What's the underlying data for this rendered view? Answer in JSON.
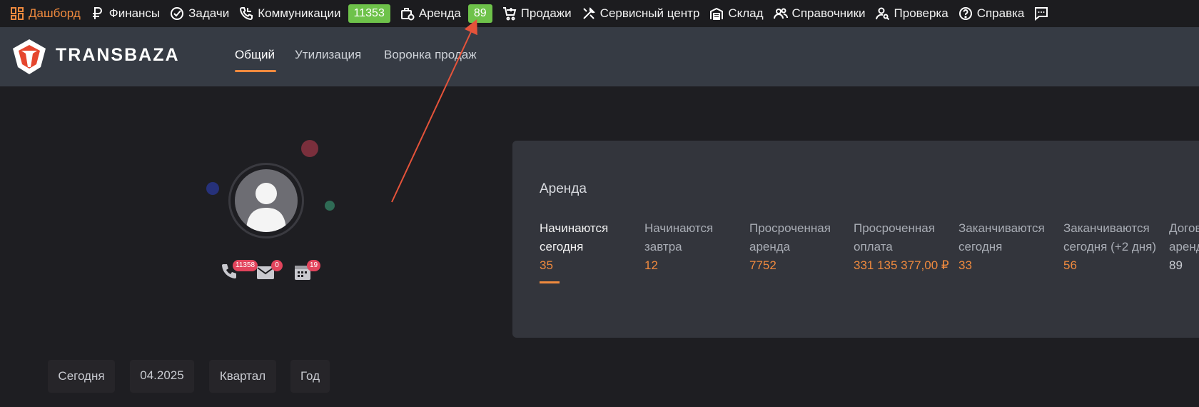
{
  "colors": {
    "accent": "#f08a3e",
    "badge_green": "#6ec24a",
    "badge_red": "#e2445c",
    "annotation_arrow": "#e5533a"
  },
  "topnav": {
    "items": [
      {
        "label": "Дашборд",
        "icon": "dashboard-icon",
        "active": true
      },
      {
        "label": "Финансы",
        "icon": "ruble-icon"
      },
      {
        "label": "Задачи",
        "icon": "check-circle-icon"
      },
      {
        "label": "Коммуникации",
        "icon": "phone-call-icon",
        "badge": "11353"
      },
      {
        "label": "Аренда",
        "icon": "briefcase-clock-icon",
        "badge": "89"
      },
      {
        "label": "Продажи",
        "icon": "cart-icon"
      },
      {
        "label": "Сервисный центр",
        "icon": "tools-icon"
      },
      {
        "label": "Склад",
        "icon": "warehouse-icon"
      },
      {
        "label": "Справочники",
        "icon": "users-icon"
      },
      {
        "label": "Проверка",
        "icon": "user-search-icon"
      },
      {
        "label": "Справка",
        "icon": "help-circle-icon"
      },
      {
        "label": "",
        "icon": "chat-icon"
      }
    ]
  },
  "brand": {
    "logo_text": "TRANSBAZA",
    "tabs": [
      "Общий",
      "Утилизация",
      "Воронка продаж"
    ],
    "active_tab": "Общий"
  },
  "profile": {
    "calls_count": "11358",
    "mail_count": "0",
    "calendar_count": "19"
  },
  "rental_card": {
    "title": "Аренда",
    "stats": [
      {
        "label": "Начинаются сегодня",
        "value": "35"
      },
      {
        "label": "Начинаются завтра",
        "value": "12"
      },
      {
        "label": "Просроченная аренда",
        "value": "7752"
      },
      {
        "label": "Просроченная оплата",
        "value": "331 135 377,00 ₽"
      },
      {
        "label": "Заканчиваются сегодня",
        "value": "33"
      },
      {
        "label": "Заканчиваются сегодня (+2 дня)",
        "value": "56"
      },
      {
        "label": "Догов аренд",
        "value": "89"
      }
    ],
    "active_stat": 0
  },
  "periods": [
    "Сегодня",
    "04.2025",
    "Квартал",
    "Год"
  ]
}
